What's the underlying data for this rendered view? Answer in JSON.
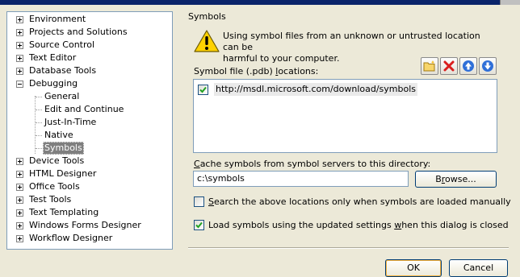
{
  "tree": {
    "items": [
      {
        "label": "Environment"
      },
      {
        "label": "Projects and Solutions"
      },
      {
        "label": "Source Control"
      },
      {
        "label": "Text Editor"
      },
      {
        "label": "Database Tools"
      },
      {
        "label": "Debugging",
        "expanded": true,
        "children": [
          "General",
          "Edit and Continue",
          "Just-In-Time",
          "Native",
          "Symbols"
        ],
        "selected_child": "Symbols"
      },
      {
        "label": "Device Tools"
      },
      {
        "label": "HTML Designer"
      },
      {
        "label": "Office Tools"
      },
      {
        "label": "Test Tools"
      },
      {
        "label": "Text Templating"
      },
      {
        "label": "Windows Forms Designer"
      },
      {
        "label": "Workflow Designer"
      }
    ]
  },
  "panel": {
    "title": "Symbols",
    "warning_line1": "Using symbol files from an unknown or untrusted location can be",
    "warning_line2": "harmful to your computer.",
    "list_label_pre": "Symbol file (.pdb) ",
    "list_label_key": "l",
    "list_label_post": "ocations:",
    "toolbar": {
      "new_folder_icon": "new-folder-icon",
      "delete_icon": "delete-icon",
      "move_up_icon": "arrow-up-icon",
      "move_down_icon": "arrow-down-icon"
    },
    "locations": [
      {
        "url": "http://msdl.microsoft.com/download/symbols",
        "checked": true
      }
    ],
    "cache_label_key": "C",
    "cache_label_rest": "ache symbols from symbol servers to this directory:",
    "cache_dir": "c:\\symbols",
    "browse_pre": "B",
    "browse_key": "r",
    "browse_post": "owse...",
    "option_manual_key": "S",
    "option_manual_rest": "earch the above locations only when symbols are loaded manually",
    "option_manual_checked": false,
    "option_load_pre": "Load symbols using the updated settings ",
    "option_load_key": "w",
    "option_load_post": "hen this dialog is closed",
    "option_load_checked": true
  },
  "buttons": {
    "ok": "OK",
    "cancel": "Cancel"
  },
  "colors": {
    "accent": "#0a246a",
    "selection": "#7f7f7f",
    "dialog_bg": "#ece9d8"
  }
}
